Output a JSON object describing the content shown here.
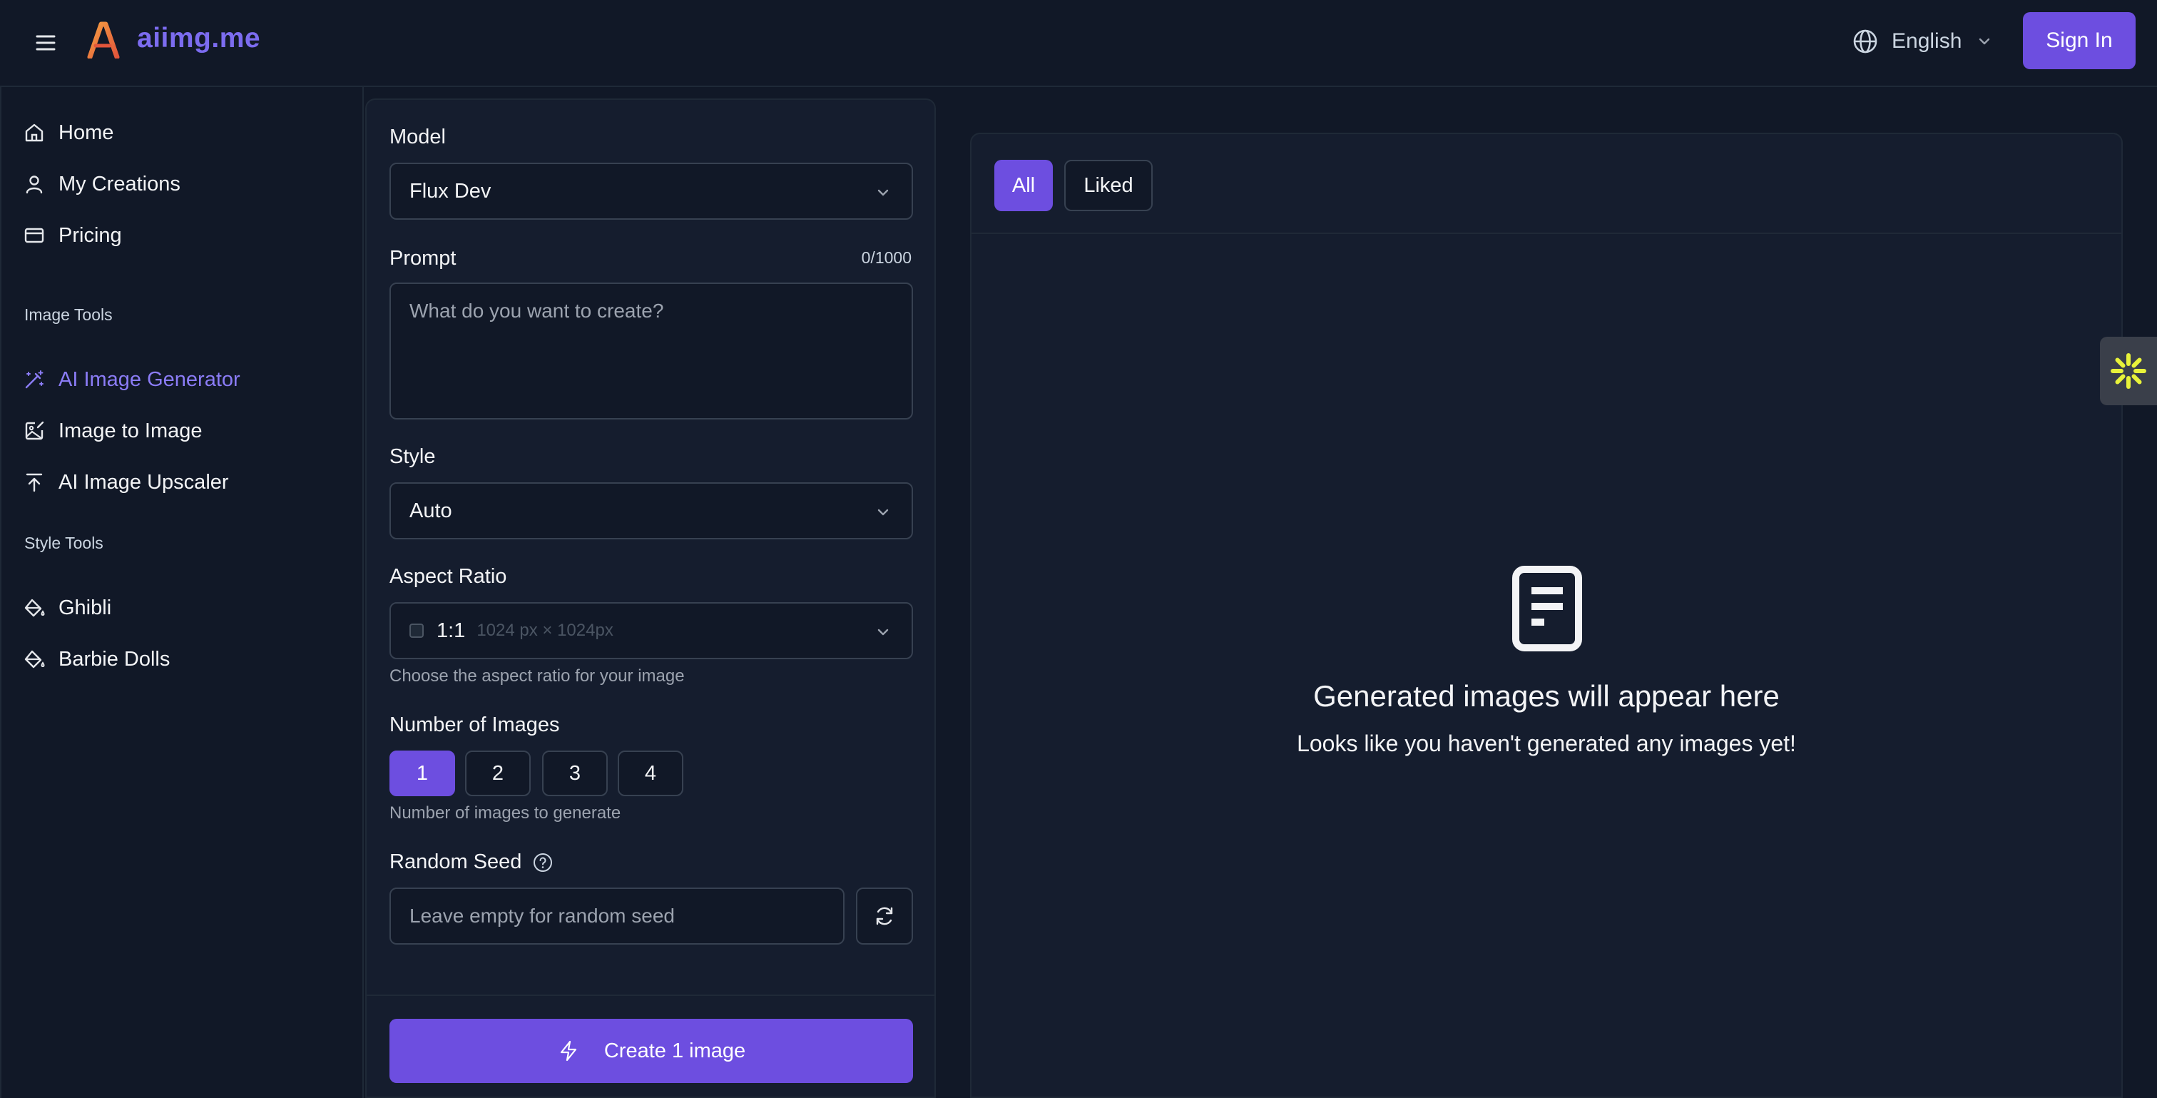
{
  "header": {
    "brand": "aiimg.me",
    "language": "English",
    "sign_in_label": "Sign In"
  },
  "sidebar": {
    "main_items": [
      {
        "label": "Home",
        "icon": "home-icon"
      },
      {
        "label": "My Creations",
        "icon": "user-icon"
      },
      {
        "label": "Pricing",
        "icon": "credit-card-icon"
      }
    ],
    "image_tools_label": "Image Tools",
    "image_tools": [
      {
        "label": "AI Image Generator",
        "icon": "magic-wand-icon",
        "active": true
      },
      {
        "label": "Image to Image",
        "icon": "image-edit-icon"
      },
      {
        "label": "AI Image Upscaler",
        "icon": "upload-arrow-icon"
      }
    ],
    "style_tools_label": "Style Tools",
    "style_tools": [
      {
        "label": "Ghibli",
        "icon": "paint-bucket-icon"
      },
      {
        "label": "Barbie Dolls",
        "icon": "paint-bucket-icon"
      }
    ]
  },
  "form": {
    "model_label": "Model",
    "model_value": "Flux Dev",
    "prompt_label": "Prompt",
    "prompt_counter": "0/1000",
    "prompt_placeholder": "What do you want to create?",
    "style_label": "Style",
    "style_value": "Auto",
    "aspect_label": "Aspect Ratio",
    "aspect_value": "1:1",
    "aspect_dimensions": "1024 px × 1024px",
    "aspect_hint": "Choose the aspect ratio for your image",
    "num_images_label": "Number of Images",
    "num_options": [
      "1",
      "2",
      "3",
      "4"
    ],
    "num_selected": "1",
    "num_hint": "Number of images to generate",
    "seed_label": "Random Seed",
    "seed_placeholder": "Leave empty for random seed",
    "create_label": "Create 1 image"
  },
  "results": {
    "tabs": [
      "All",
      "Liked"
    ],
    "active_tab": "All",
    "empty_title": "Generated images will appear here",
    "empty_subtitle": "Looks like you haven't generated any images yet!"
  },
  "colors": {
    "background": "#111827",
    "panel": "#151d2e",
    "accent": "#6d4ee0",
    "accent_text": "#8b7cf6",
    "widget_star": "#e8f23a"
  }
}
